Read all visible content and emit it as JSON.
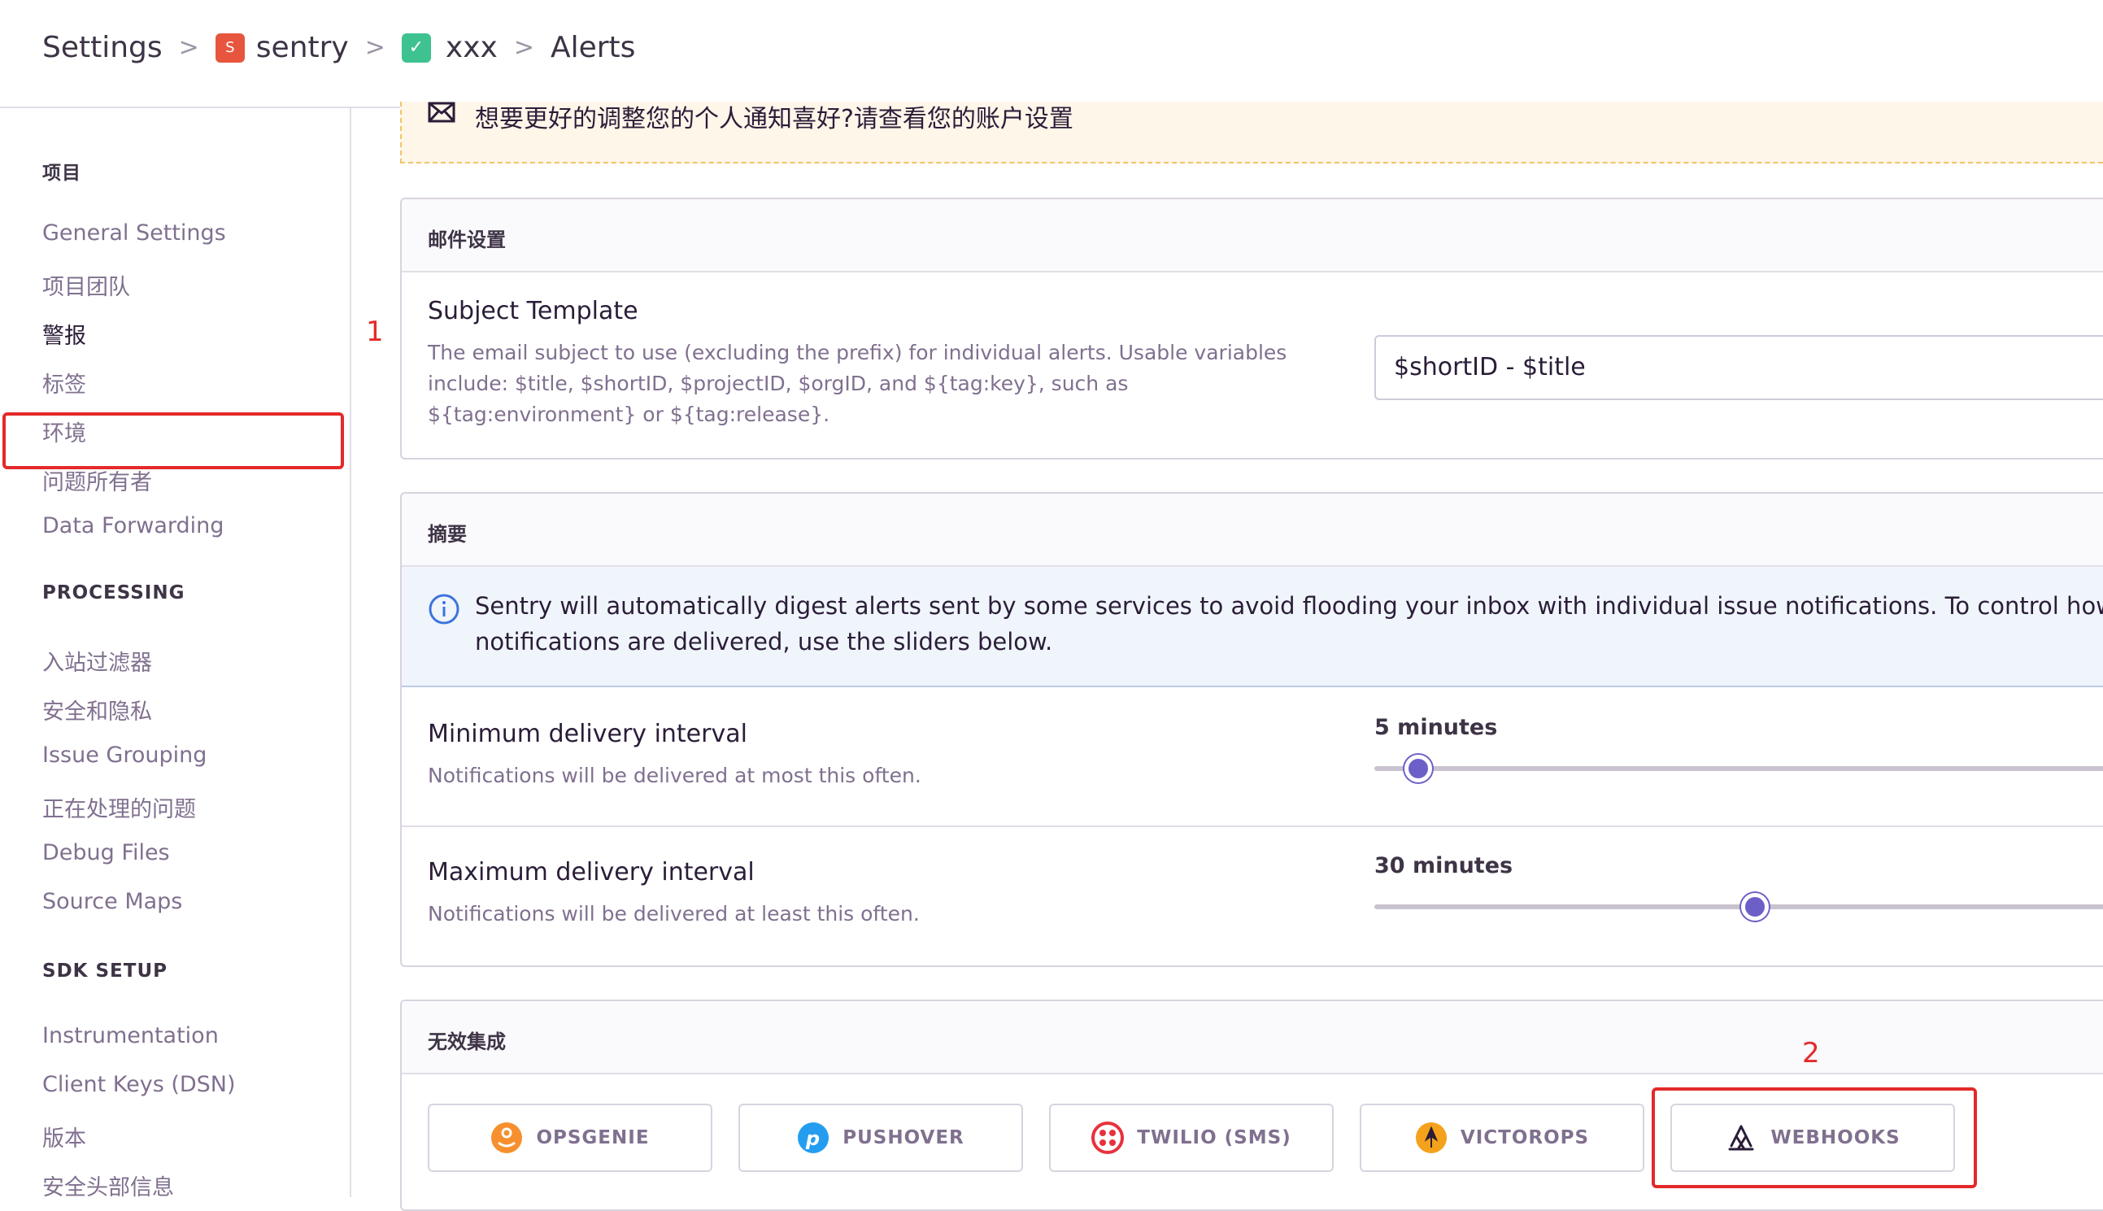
{
  "header": {
    "crumbs": [
      "Settings",
      "sentry",
      "xxx",
      "Alerts"
    ],
    "sentry_badge": "S",
    "project_badge": "✓"
  },
  "sidebar": {
    "sections": [
      {
        "title": "项目",
        "items": [
          "General Settings",
          "项目团队",
          "警报",
          "标签",
          "环境",
          "问题所有者",
          "Data Forwarding"
        ]
      },
      {
        "title": "PROCESSING",
        "items": [
          "入站过滤器",
          "安全和隐私",
          "Issue Grouping",
          "正在处理的问题",
          "Debug Files",
          "Source Maps"
        ]
      },
      {
        "title": "SDK SETUP",
        "items": [
          "Instrumentation",
          "Client Keys (DSN)",
          "版本",
          "安全头部信息"
        ]
      }
    ],
    "active_item": "警报"
  },
  "annotations": {
    "first": "1",
    "second": "2"
  },
  "warning": {
    "text": "想要更好的调整您的个人通知喜好?请查看您的账户设置"
  },
  "email_panel": {
    "title": "邮件设置",
    "subject_label": "Subject Template",
    "subject_help_1": "The email subject to use (excluding the prefix) for individual alerts. Usable variables",
    "subject_help_2": "include: $title, $shortID, $projectID, $orgID, and ${tag:key}, such as",
    "subject_help_3": "${tag:environment} or ${tag:release}.",
    "subject_value": "$shortID - $title"
  },
  "digest_panel": {
    "title": "摘要",
    "info_line_1": "Sentry will automatically digest alerts sent by some services to avoid flooding your inbox with individual issue notifications. To control how freque",
    "info_line_2": "notifications are delivered, use the sliders below.",
    "min": {
      "label": "Minimum delivery interval",
      "help": "Notifications will be delivered at most this often.",
      "value": "5 minutes",
      "position": 0.06
    },
    "max": {
      "label": "Maximum delivery interval",
      "help": "Notifications will be delivered at least this often.",
      "value": "30 minutes",
      "position": 0.52
    }
  },
  "integrations_panel": {
    "title": "无效集成",
    "items": [
      {
        "label": "OPSGENIE",
        "icon": "opsgenie-icon",
        "color": "#f6902e"
      },
      {
        "label": "PUSHOVER",
        "icon": "pushover-icon",
        "color": "#249df1"
      },
      {
        "label": "TWILIO (SMS)",
        "icon": "twilio-icon",
        "color": "#e8313d"
      },
      {
        "label": "VICTOROPS",
        "icon": "victorops-icon",
        "color": "#f4a21b"
      },
      {
        "label": "WEBHOOKS",
        "icon": "webhooks-icon",
        "color": "#2b1d38"
      }
    ]
  },
  "colors": {
    "accent": "#6c5fc7",
    "annotation": "#e32a2a"
  }
}
